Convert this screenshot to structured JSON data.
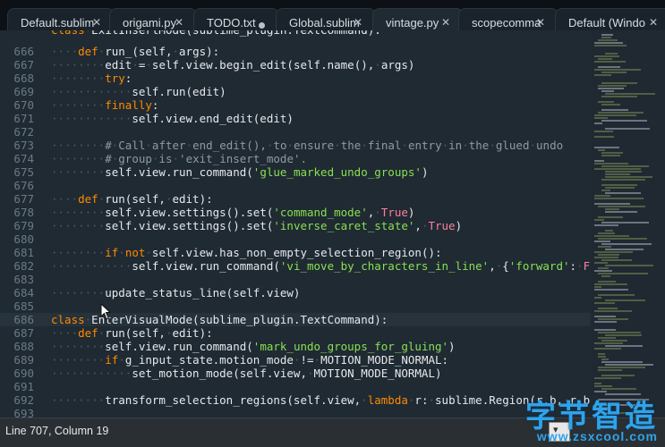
{
  "tabs": [
    {
      "label": "Default.sublim",
      "close": "close-icon"
    },
    {
      "label": "origami.py",
      "close": "close-icon"
    },
    {
      "label": "TODO.txt",
      "close": "dirty-dot-icon"
    },
    {
      "label": "Global.sublime",
      "close": "close-icon"
    },
    {
      "label": "vintage.py",
      "close": "close-icon",
      "active": true
    },
    {
      "label": "scopecommand",
      "close": "close-icon"
    },
    {
      "label": "Default (Windo",
      "close": "close-icon"
    }
  ],
  "editor": {
    "partial_top_line": "class ExitInsertMode(sublime_plugin.TextCommand):",
    "lines": [
      {
        "num": "666",
        "text": "    def run_(self, args):"
      },
      {
        "num": "667",
        "text": "        edit = self.view.begin_edit(self.name(), args)"
      },
      {
        "num": "668",
        "text": "        try:"
      },
      {
        "num": "669",
        "text": "            self.run(edit)"
      },
      {
        "num": "670",
        "text": "        finally:"
      },
      {
        "num": "671",
        "text": "            self.view.end_edit(edit)"
      },
      {
        "num": "672",
        "text": ""
      },
      {
        "num": "673",
        "text": "        # Call after end_edit(), to ensure the final entry in the glued undo"
      },
      {
        "num": "674",
        "text": "        # group is 'exit_insert_mode'."
      },
      {
        "num": "675",
        "text": "        self.view.run_command('glue_marked_undo_groups')"
      },
      {
        "num": "676",
        "text": ""
      },
      {
        "num": "677",
        "text": "    def run(self, edit):"
      },
      {
        "num": "678",
        "text": "        self.view.settings().set('command_mode', True)"
      },
      {
        "num": "679",
        "text": "        self.view.settings().set('inverse_caret_state', True)"
      },
      {
        "num": "680",
        "text": ""
      },
      {
        "num": "681",
        "text": "        if not self.view.has_non_empty_selection_region():"
      },
      {
        "num": "682",
        "text": "            self.view.run_command('vi_move_by_characters_in_line', {'forward': False})"
      },
      {
        "num": "683",
        "text": ""
      },
      {
        "num": "684",
        "text": "        update_status_line(self.view)"
      },
      {
        "num": "685",
        "text": ""
      },
      {
        "num": "686",
        "text": "class EnterVisualMode(sublime_plugin.TextCommand):"
      },
      {
        "num": "687",
        "text": "    def run(self, edit):"
      },
      {
        "num": "688",
        "text": "        self.view.run_command('mark_undo_groups_for_gluing')"
      },
      {
        "num": "689",
        "text": "        if g_input_state.motion_mode != MOTION_MODE_NORMAL:"
      },
      {
        "num": "690",
        "text": "            set_motion_mode(self.view, MOTION_MODE_NORMAL)"
      },
      {
        "num": "691",
        "text": ""
      },
      {
        "num": "692",
        "text": "        transform_selection_regions(self.view, lambda r: sublime.Region(r.b, r.b))"
      },
      {
        "num": "693",
        "text": ""
      }
    ],
    "current_line": "686"
  },
  "status": {
    "position": "Line 707, Column 19",
    "button_glyph": "▾"
  },
  "watermark": {
    "main": "字节智造",
    "sub": "www.zsxcool.com"
  },
  "colors": {
    "background": "#1f2a33",
    "keyword": "#ff8a00",
    "string": "#89e051",
    "comment": "#8e9aa4",
    "accent": "#2fa3ea"
  }
}
